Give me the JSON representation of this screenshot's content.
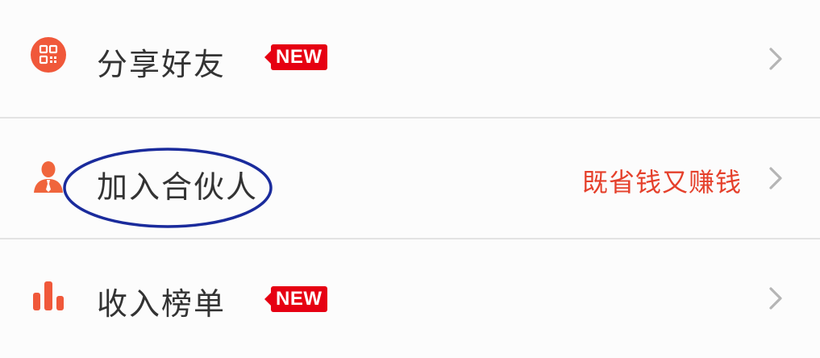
{
  "menu": {
    "items": [
      {
        "id": "share",
        "label": "分享好友",
        "badge": "NEW",
        "promo": "",
        "icon": "qr-code-icon"
      },
      {
        "id": "partner",
        "label": "加入合伙人",
        "badge": "",
        "promo": "既省钱又赚钱",
        "icon": "person-icon"
      },
      {
        "id": "income-rank",
        "label": "收入榜单",
        "badge": "NEW",
        "promo": "",
        "icon": "bar-chart-icon"
      }
    ]
  },
  "colors": {
    "icon_accent": "#f0583a",
    "badge_bg": "#e60012",
    "promo_text": "#e5402b",
    "label_text": "#333333",
    "chevron": "#b5b5b5",
    "annotation_ellipse": "#1a2b9c"
  }
}
